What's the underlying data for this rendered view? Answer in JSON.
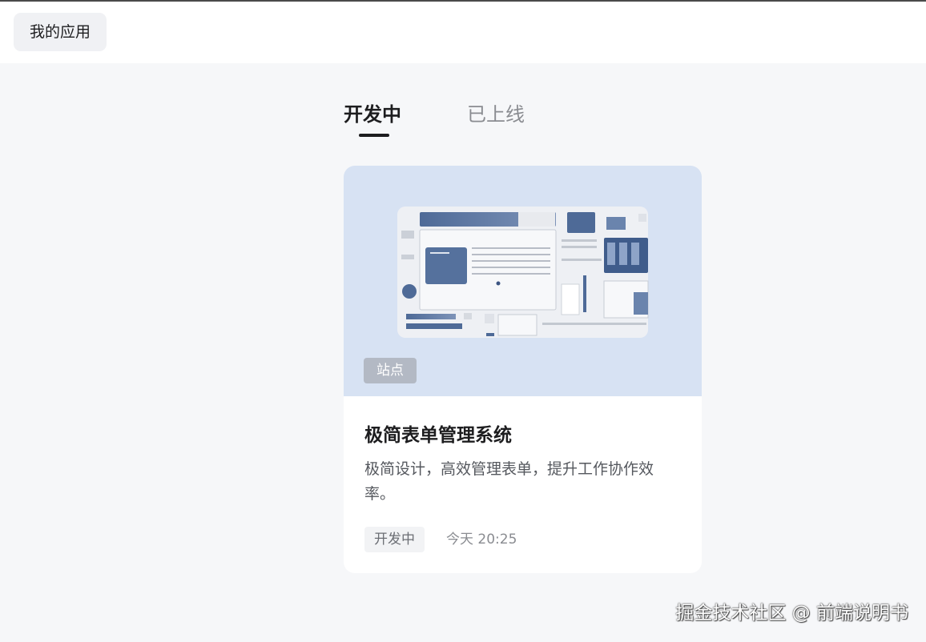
{
  "header": {
    "app_button_label": "我的应用"
  },
  "tabs": [
    {
      "label": "开发中",
      "active": true
    },
    {
      "label": "已上线",
      "active": false
    }
  ],
  "card": {
    "type_tag": "站点",
    "title": "极简表单管理系统",
    "description": "极简设计，高效管理表单，提升工作协作效率。",
    "status": "开发中",
    "updated": "今天 20:25",
    "cover_color": "#d7e2f3",
    "accent_color": "#4e6a97"
  },
  "watermark": "掘金技术社区 @ 前端说明书"
}
